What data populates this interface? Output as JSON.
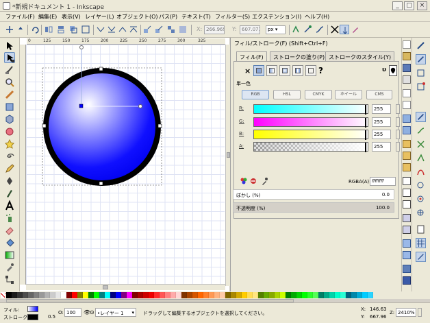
{
  "window": {
    "title": "*新規ドキュメント 1 - Inkscape",
    "min": "_",
    "max": "□",
    "close": "×"
  },
  "menu": [
    "ファイル(F)",
    "編集(E)",
    "表示(V)",
    "レイヤー(L)",
    "オブジェクト(O)",
    "パス(P)",
    "テキスト(T)",
    "フィルター(S)",
    "エクステンション(I)",
    "ヘルプ(H)"
  ],
  "toolbar": {
    "x_label": "X:",
    "x_value": "266.969",
    "y_label": "Y:",
    "y_value": "607.071",
    "unit": "px"
  },
  "ruler": {
    "h_ticks": [
      "0",
      "125",
      "150",
      "175",
      "200",
      "225",
      "250",
      "275",
      "300",
      "325"
    ]
  },
  "dialog": {
    "title": "フィル/ストローク(F) (Shift+Ctrl+F)",
    "tabs": [
      "フィル(F)",
      "ストロークの塗り(P)",
      "ストロークのスタイル(Y)"
    ],
    "no_paint": "×",
    "unset": "?",
    "section": "単一色",
    "modes": [
      "RGB",
      "HSL",
      "CMYK",
      "ホイール",
      "CMS"
    ],
    "channels": [
      {
        "label": "R:",
        "value": "255",
        "color": "#00ffff"
      },
      {
        "label": "G:",
        "value": "255",
        "color": "#ff00ff"
      },
      {
        "label": "B:",
        "value": "255",
        "color": "#ffff00"
      },
      {
        "label": "A:",
        "value": "255",
        "color": "#000000"
      }
    ],
    "rgba_label": "RGBA(A):",
    "rgba_value": "ffffffff",
    "blur_label": "ぼかし (%)",
    "blur_value": "0.0",
    "opacity_label": "不透明度 (%)",
    "opacity_value": "100.0"
  },
  "status": {
    "fill_label": "フィル:",
    "stroke_label": "ストローク:",
    "stroke_width": "0.5",
    "opacity_label": "O:",
    "opacity_value": "100",
    "layer": "•レイヤー 1",
    "message": "ドラッグして編集するオブジェクトを選択してください。",
    "x_label": "X:",
    "x_value": "146.63",
    "y_label": "Y:",
    "y_value": "667.96",
    "zoom_label": "Z:",
    "zoom_value": "2410%"
  },
  "colors": {
    "accent": "#0000ff",
    "selected_tool": "#c5d4ea"
  }
}
